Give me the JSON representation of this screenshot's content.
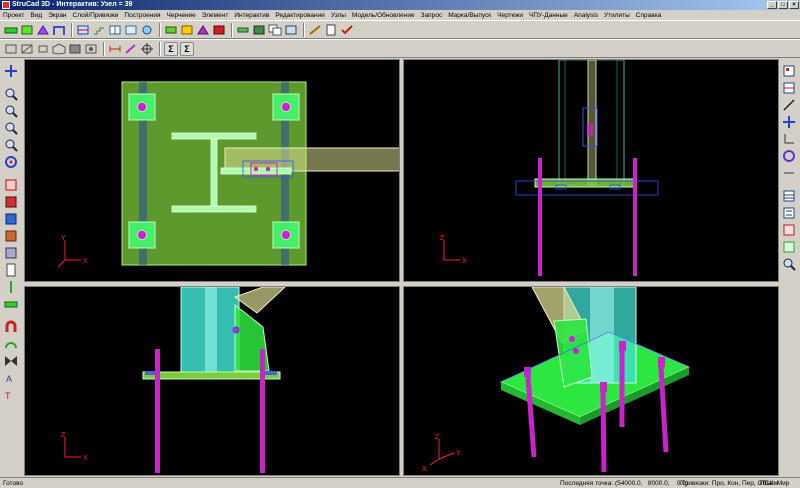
{
  "window": {
    "title": "StruCad 3D - Интерактив: Узел = 39"
  },
  "menu": [
    "Проект",
    "Вид",
    "Экран",
    "Слой/Привязки",
    "Построения",
    "Черчение",
    "Элемент",
    "Интерактив",
    "Редактирование",
    "Узлы",
    "Модель/Обновление",
    "Запрос",
    "Марка/Выпуск",
    "Чертежи",
    "ЧПУ-Данные",
    "Analysis",
    "Утилиты",
    "Справка"
  ],
  "toolbar_icons": {
    "row1": [
      "beam-icon",
      "column-icon",
      "brace-icon",
      "portal-icon",
      "connection-icon",
      "stair-icon",
      "grid-icon",
      "window-icon",
      "node-icon",
      "plate-icon",
      "bolt-icon",
      "weld-icon",
      "cut-icon",
      "member-icon",
      "assembly-icon",
      "copy-icon",
      "view-icon",
      "pencil-icon",
      "sheet-icon",
      "check-icon"
    ],
    "row2": [
      "view-front-icon",
      "view-side-icon",
      "view-top-icon",
      "view-iso-icon",
      "view-box-icon",
      "render-icon",
      "measure-icon",
      "pen-icon",
      "crosshair-icon",
      "sum-icon",
      "sum-bar-icon"
    ]
  },
  "axes": {
    "plan": {
      "v": "Y",
      "h": "X"
    },
    "front": {
      "v": "Z",
      "h": "X"
    },
    "front2": {
      "v": "Z",
      "h": "X"
    },
    "iso": {
      "v": "Z",
      "h1": "X",
      "h2": "Y"
    }
  },
  "colors": {
    "viewport_bg": "#000000",
    "plate": "#7ccc3c",
    "column": "#40e0d0",
    "bolt": "#cc22cc",
    "brace": "#d8d890",
    "selection": "#3050ff",
    "axis": "#ff2020"
  },
  "status": {
    "left": "Готово",
    "last_point_label": "Последняя точка: (",
    "last_point_values": "54000.0,   8000.0,    0.0)",
    "snaps": "Привязки: Про, Кон, Пер, Объем",
    "ucs": "ПСК: Мир"
  }
}
